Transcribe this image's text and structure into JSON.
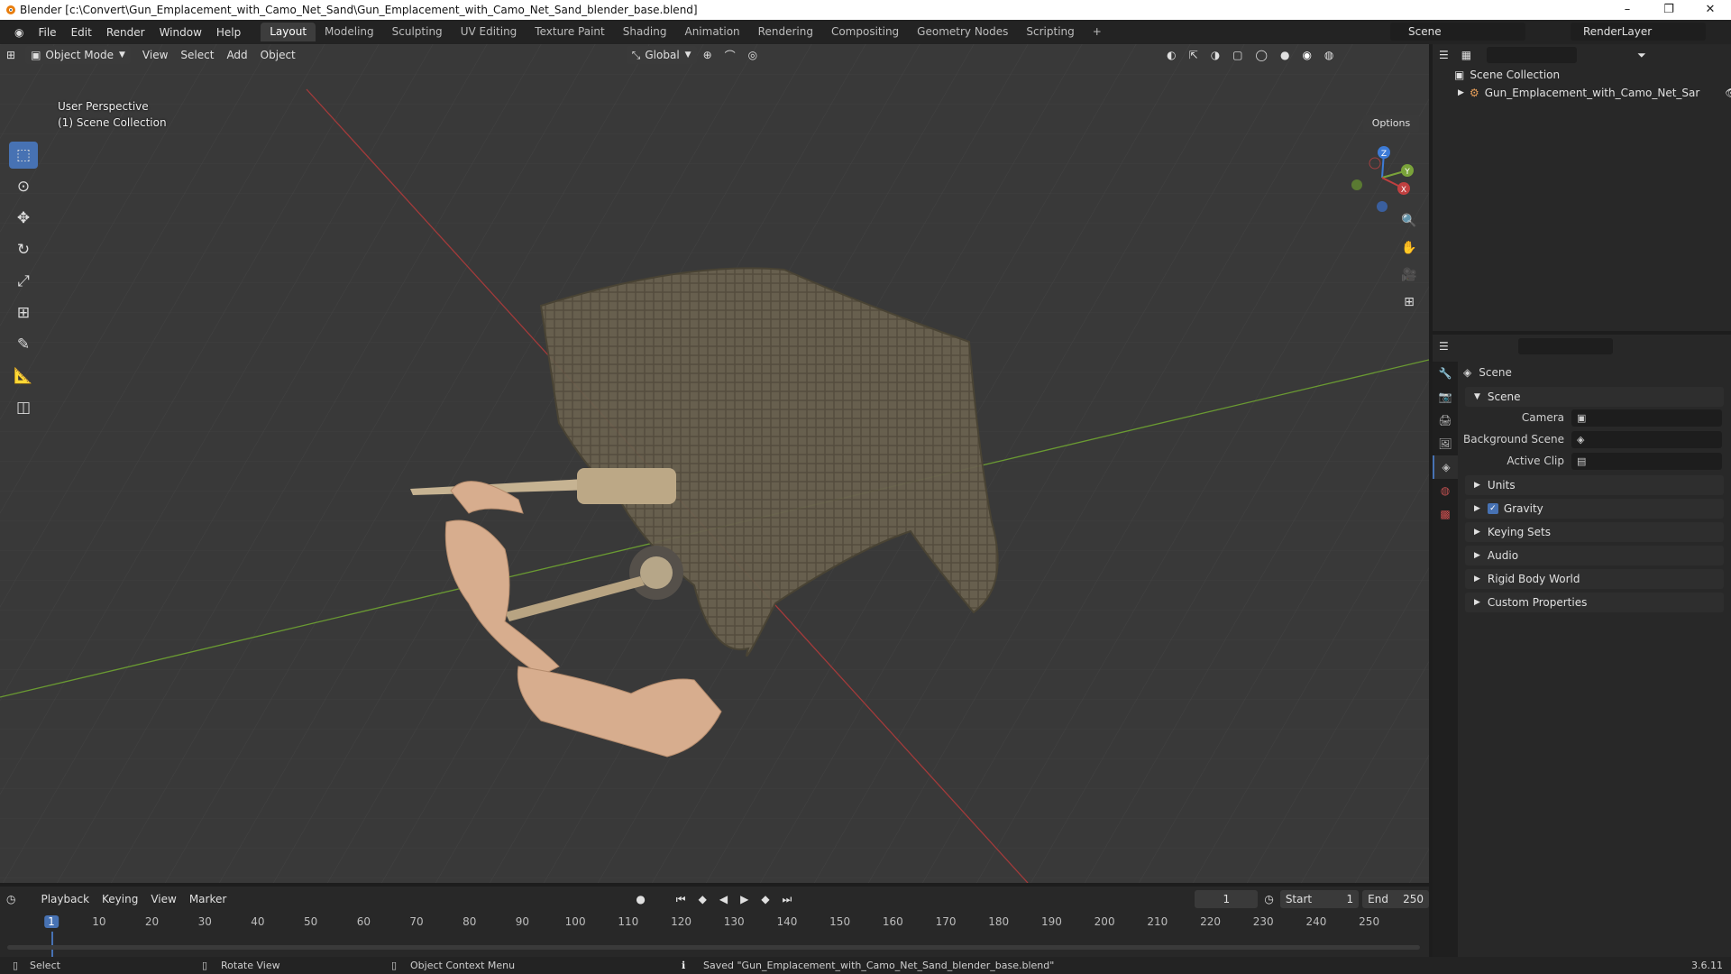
{
  "titlebar": {
    "title": "Blender [c:\\Convert\\Gun_Emplacement_with_Camo_Net_Sand\\Gun_Emplacement_with_Camo_Net_Sand_blender_base.blend]",
    "min": "–",
    "max": "❐",
    "close": "✕"
  },
  "menu": {
    "items": [
      "File",
      "Edit",
      "Render",
      "Window",
      "Help"
    ]
  },
  "workspaces": [
    "Layout",
    "Modeling",
    "Sculpting",
    "UV Editing",
    "Texture Paint",
    "Shading",
    "Animation",
    "Rendering",
    "Compositing",
    "Geometry Nodes",
    "Scripting"
  ],
  "workspace_add": "+",
  "scene_field": "Scene",
  "renderlayer_field": "RenderLayer",
  "viewport": {
    "mode": "Object Mode",
    "menus": [
      "View",
      "Select",
      "Add",
      "Object"
    ],
    "transform_orientation": "Global",
    "options": "Options",
    "overlay_line1": "User Perspective",
    "overlay_line2": "(1) Scene Collection",
    "gizmo": {
      "z": "Z",
      "y": "Y",
      "x": "X"
    }
  },
  "outliner": {
    "root": "Scene Collection",
    "child": "Gun_Emplacement_with_Camo_Net_Sar"
  },
  "properties": {
    "title": "Scene",
    "panel": "Scene",
    "camera_label": "Camera",
    "background_label": "Background Scene",
    "clip_label": "Active Clip",
    "sections": [
      "Units",
      "Gravity",
      "Keying Sets",
      "Audio",
      "Rigid Body World",
      "Custom Properties"
    ],
    "gravity_checked": true
  },
  "timeline": {
    "menus": [
      "Playback",
      "Keying",
      "View",
      "Marker"
    ],
    "current_frame": "1",
    "start_label": "Start",
    "start": "1",
    "end_label": "End",
    "end": "250",
    "ticks": [
      "1",
      "10",
      "20",
      "30",
      "40",
      "50",
      "60",
      "70",
      "80",
      "90",
      "100",
      "110",
      "120",
      "130",
      "140",
      "150",
      "160",
      "170",
      "180",
      "190",
      "200",
      "210",
      "220",
      "230",
      "240",
      "250"
    ]
  },
  "status": {
    "select": "Select",
    "rotate": "Rotate View",
    "context": "Object Context Menu",
    "message": "Saved \"Gun_Emplacement_with_Camo_Net_Sand_blender_base.blend\"",
    "version": "3.6.11"
  },
  "colors": {
    "accent": "#4772b3",
    "x_axis": "#c04040",
    "y_axis": "#7aa33a"
  }
}
